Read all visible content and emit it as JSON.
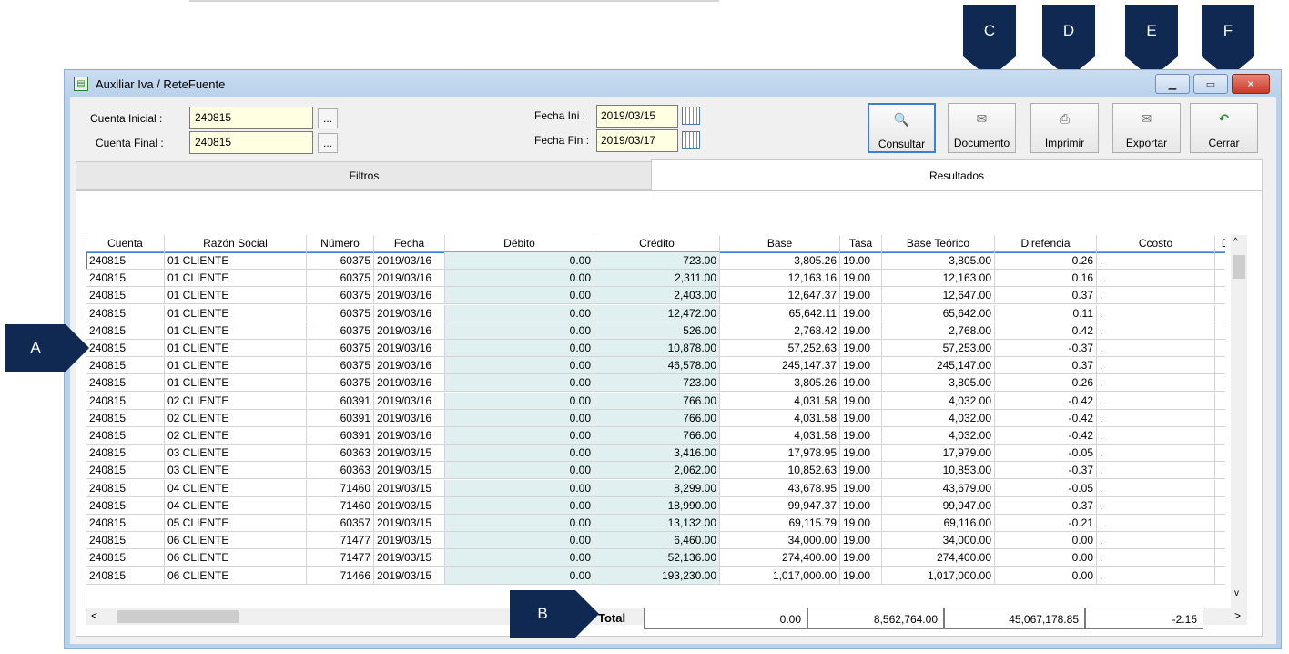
{
  "window": {
    "title": "Auxiliar Iva / ReteFuente"
  },
  "form": {
    "cuenta_inicial_label": "Cuenta Inicial :",
    "cuenta_inicial_value": "240815",
    "cuenta_final_label": "Cuenta Final :",
    "cuenta_final_value": "240815",
    "ellipsis": "...",
    "fecha_ini_label": "Fecha Ini :",
    "fecha_ini_value": "2019/03/15",
    "fecha_fin_label": "Fecha Fin :",
    "fecha_fin_value": "2019/03/17"
  },
  "toolbar": {
    "consultar": "Consultar",
    "documento": "Documento",
    "imprimir": "Imprimir",
    "exportar": "Exportar",
    "cerrar": "Cerrar"
  },
  "tabs": {
    "filtros": "Filtros",
    "resultados": "Resultados"
  },
  "grid": {
    "headers": [
      "Cuenta",
      "Razón Social",
      "Número",
      "Fecha",
      "Débito",
      "Crédito",
      "Base",
      "Tasa",
      "Base Teórico",
      "Direfencia",
      "Ccosto",
      "De"
    ],
    "rows": [
      [
        "240815",
        "01 CLIENTE",
        "60375",
        "2019/03/16",
        "0.00",
        "723.00",
        "3,805.26",
        "19.00",
        "3,805.00",
        "0.26",
        "."
      ],
      [
        "240815",
        "01 CLIENTE",
        "60375",
        "2019/03/16",
        "0.00",
        "2,311.00",
        "12,163.16",
        "19.00",
        "12,163.00",
        "0.16",
        "."
      ],
      [
        "240815",
        "01 CLIENTE",
        "60375",
        "2019/03/16",
        "0.00",
        "2,403.00",
        "12,647.37",
        "19.00",
        "12,647.00",
        "0.37",
        "."
      ],
      [
        "240815",
        "01 CLIENTE",
        "60375",
        "2019/03/16",
        "0.00",
        "12,472.00",
        "65,642.11",
        "19.00",
        "65,642.00",
        "0.11",
        "."
      ],
      [
        "240815",
        "01 CLIENTE",
        "60375",
        "2019/03/16",
        "0.00",
        "526.00",
        "2,768.42",
        "19.00",
        "2,768.00",
        "0.42",
        "."
      ],
      [
        "240815",
        "01 CLIENTE",
        "60375",
        "2019/03/16",
        "0.00",
        "10,878.00",
        "57,252.63",
        "19.00",
        "57,253.00",
        "-0.37",
        "."
      ],
      [
        "240815",
        "01 CLIENTE",
        "60375",
        "2019/03/16",
        "0.00",
        "46,578.00",
        "245,147.37",
        "19.00",
        "245,147.00",
        "0.37",
        "."
      ],
      [
        "240815",
        "01 CLIENTE",
        "60375",
        "2019/03/16",
        "0.00",
        "723.00",
        "3,805.26",
        "19.00",
        "3,805.00",
        "0.26",
        "."
      ],
      [
        "240815",
        "02 CLIENTE",
        "60391",
        "2019/03/16",
        "0.00",
        "766.00",
        "4,031.58",
        "19.00",
        "4,032.00",
        "-0.42",
        "."
      ],
      [
        "240815",
        "02 CLIENTE",
        "60391",
        "2019/03/16",
        "0.00",
        "766.00",
        "4,031.58",
        "19.00",
        "4,032.00",
        "-0.42",
        "."
      ],
      [
        "240815",
        "02 CLIENTE",
        "60391",
        "2019/03/16",
        "0.00",
        "766.00",
        "4,031.58",
        "19.00",
        "4,032.00",
        "-0.42",
        "."
      ],
      [
        "240815",
        "03 CLIENTE",
        "60363",
        "2019/03/15",
        "0.00",
        "3,416.00",
        "17,978.95",
        "19.00",
        "17,979.00",
        "-0.05",
        "."
      ],
      [
        "240815",
        "03 CLIENTE",
        "60363",
        "2019/03/15",
        "0.00",
        "2,062.00",
        "10,852.63",
        "19.00",
        "10,853.00",
        "-0.37",
        "."
      ],
      [
        "240815",
        "04 CLIENTE",
        "71460",
        "2019/03/15",
        "0.00",
        "8,299.00",
        "43,678.95",
        "19.00",
        "43,679.00",
        "-0.05",
        "."
      ],
      [
        "240815",
        "04 CLIENTE",
        "71460",
        "2019/03/15",
        "0.00",
        "18,990.00",
        "99,947.37",
        "19.00",
        "99,947.00",
        "0.37",
        "."
      ],
      [
        "240815",
        "05 CLIENTE",
        "60357",
        "2019/03/15",
        "0.00",
        "13,132.00",
        "69,115.79",
        "19.00",
        "69,116.00",
        "-0.21",
        "."
      ],
      [
        "240815",
        "06 CLIENTE",
        "71477",
        "2019/03/15",
        "0.00",
        "6,460.00",
        "34,000.00",
        "19.00",
        "34,000.00",
        "0.00",
        "."
      ],
      [
        "240815",
        "06 CLIENTE",
        "71477",
        "2019/03/15",
        "0.00",
        "52,136.00",
        "274,400.00",
        "19.00",
        "274,400.00",
        "0.00",
        "."
      ],
      [
        "240815",
        "06 CLIENTE",
        "71466",
        "2019/03/15",
        "0.00",
        "193,230.00",
        "1,017,000.00",
        "19.00",
        "1,017,000.00",
        "0.00",
        "."
      ]
    ]
  },
  "totals": {
    "label": "Total",
    "debito": "0.00",
    "credito": "8,562,764.00",
    "base": "45,067,178.85",
    "diferencia": "-2.15"
  },
  "callouts": {
    "a": "A",
    "b": "B",
    "c": "C",
    "d": "D",
    "e": "E",
    "f": "F"
  },
  "scroll": {
    "left": "<",
    "right": ">",
    "up": "^",
    "down": "v"
  },
  "icons": {
    "title": "spreadsheet-icon",
    "consultar": "magnifier-icon",
    "documento": "document-icon",
    "imprimir": "printer-icon",
    "exportar": "export-icon",
    "cerrar": "undo-arrow-icon"
  },
  "colors": {
    "window_frame": "#b9d1ea",
    "input_bg": "#ffffe1",
    "callout": "#0f2952",
    "shade_col": "#e0f0f0",
    "close_red": "#c73a27"
  }
}
